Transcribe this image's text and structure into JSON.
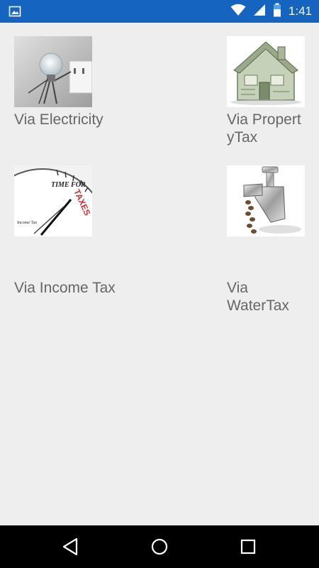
{
  "status_bar": {
    "time": "1:41",
    "left_icon": "image-icon",
    "icons": [
      "wifi-icon",
      "signal-icon",
      "battery-icon"
    ],
    "color": "#1565c0"
  },
  "tiles": [
    {
      "label": "Via Electricity",
      "image": "electricity-image"
    },
    {
      "label": "Via PropertyTax",
      "image": "property-tax-image"
    },
    {
      "label": "Via Income Tax",
      "image": "income-tax-image"
    },
    {
      "label": "Via WaterTax",
      "image": "water-tax-image"
    }
  ],
  "nav_bar": {
    "buttons": [
      "back-button",
      "home-button",
      "recents-button"
    ]
  }
}
